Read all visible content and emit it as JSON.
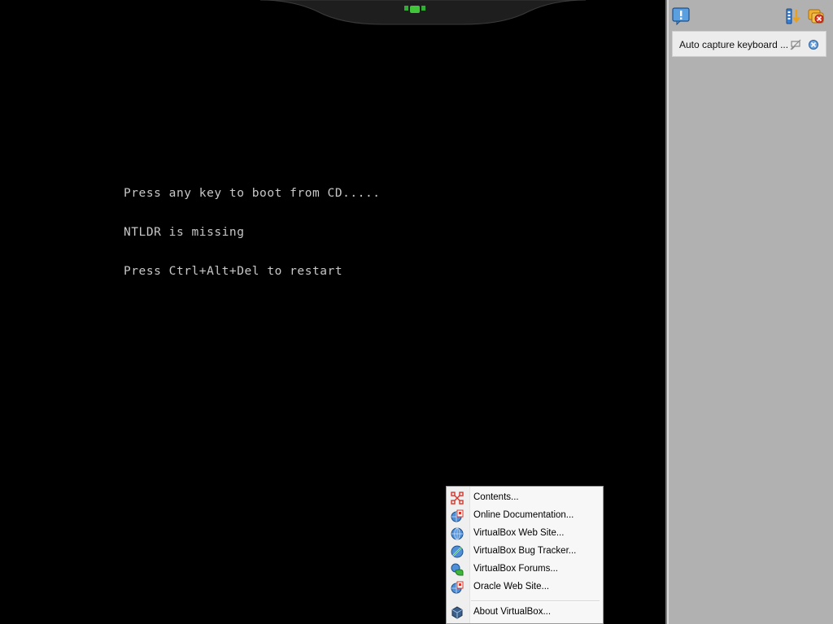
{
  "console": {
    "lines": [
      "Press any key to boot from CD.....",
      "NTLDR is missing",
      "Press Ctrl+Alt+Del to restart"
    ]
  },
  "notification_panel": {
    "message": "Auto capture keyboard ...",
    "icons": [
      "message-icon",
      "sort-icon",
      "close-all-icon",
      "dont-show-again-icon",
      "close-message-icon"
    ]
  },
  "help_menu": {
    "items": [
      {
        "label": "Contents...",
        "icon": "contents-icon"
      },
      {
        "label": "Online Documentation...",
        "icon": "online-docs-icon"
      },
      {
        "label": "VirtualBox Web Site...",
        "icon": "web-site-icon"
      },
      {
        "label": "VirtualBox Bug Tracker...",
        "icon": "bug-tracker-icon"
      },
      {
        "label": "VirtualBox Forums...",
        "icon": "forums-icon"
      },
      {
        "label": "Oracle Web Site...",
        "icon": "oracle-site-icon"
      },
      {
        "label": "About VirtualBox...",
        "icon": "about-icon"
      }
    ]
  },
  "colors": {
    "console_text": "#c8c8c8",
    "panel_bg": "#b1b1b1",
    "indicator_green": "#2fae33"
  }
}
